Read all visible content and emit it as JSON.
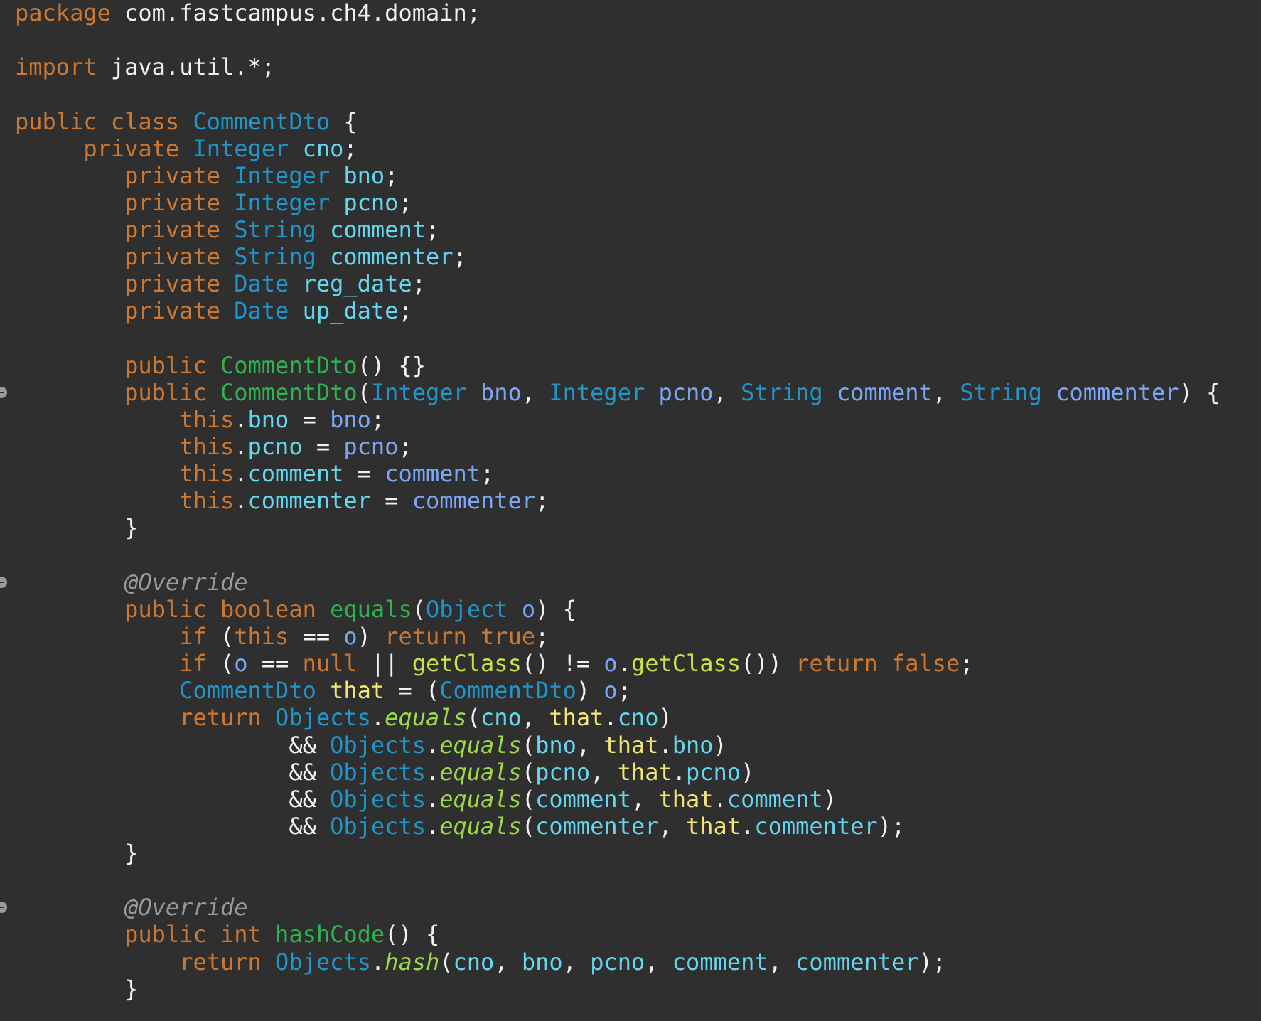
{
  "editor": {
    "language": "java",
    "theme_colors": {
      "background": "#2f2f2f",
      "plain": "#f2f2f2",
      "keyword": "#cc7832",
      "type": "#1f95c9",
      "field": "#66d6ef",
      "parameter": "#7aa6f5",
      "method_declaration": "#2fb24f",
      "method_call": "#c8e346",
      "static_method": "#9bd94a",
      "annotation": "#9a9a9a",
      "local_variable": "#f3e575"
    },
    "fold_marker_lines": [
      14,
      21,
      33
    ],
    "lines": [
      [
        [
          "kw",
          "package"
        ],
        [
          "plain",
          " com.fastcampus.ch4.domain;"
        ]
      ],
      [],
      [
        [
          "kw",
          "import"
        ],
        [
          "plain",
          " java.util.*;"
        ]
      ],
      [],
      [
        [
          "kw",
          "public class"
        ],
        [
          "plain",
          " "
        ],
        [
          "type",
          "CommentDto"
        ],
        [
          "plain",
          " {"
        ]
      ],
      [
        [
          "plain",
          "     "
        ],
        [
          "kw",
          "private"
        ],
        [
          "plain",
          " "
        ],
        [
          "type",
          "Integer"
        ],
        [
          "plain",
          " "
        ],
        [
          "field",
          "cno"
        ],
        [
          "plain",
          ";"
        ]
      ],
      [
        [
          "plain",
          "        "
        ],
        [
          "kw",
          "private"
        ],
        [
          "plain",
          " "
        ],
        [
          "type",
          "Integer"
        ],
        [
          "plain",
          " "
        ],
        [
          "field",
          "bno"
        ],
        [
          "plain",
          ";"
        ]
      ],
      [
        [
          "plain",
          "        "
        ],
        [
          "kw",
          "private"
        ],
        [
          "plain",
          " "
        ],
        [
          "type",
          "Integer"
        ],
        [
          "plain",
          " "
        ],
        [
          "field",
          "pcno"
        ],
        [
          "plain",
          ";"
        ]
      ],
      [
        [
          "plain",
          "        "
        ],
        [
          "kw",
          "private"
        ],
        [
          "plain",
          " "
        ],
        [
          "type",
          "String"
        ],
        [
          "plain",
          " "
        ],
        [
          "field",
          "comment"
        ],
        [
          "plain",
          ";"
        ]
      ],
      [
        [
          "plain",
          "        "
        ],
        [
          "kw",
          "private"
        ],
        [
          "plain",
          " "
        ],
        [
          "type",
          "String"
        ],
        [
          "plain",
          " "
        ],
        [
          "field",
          "commenter"
        ],
        [
          "plain",
          ";"
        ]
      ],
      [
        [
          "plain",
          "        "
        ],
        [
          "kw",
          "private"
        ],
        [
          "plain",
          " "
        ],
        [
          "type",
          "Date"
        ],
        [
          "plain",
          " "
        ],
        [
          "field",
          "reg_date"
        ],
        [
          "plain",
          ";"
        ]
      ],
      [
        [
          "plain",
          "        "
        ],
        [
          "kw",
          "private"
        ],
        [
          "plain",
          " "
        ],
        [
          "type",
          "Date"
        ],
        [
          "plain",
          " "
        ],
        [
          "field",
          "up_date"
        ],
        [
          "plain",
          ";"
        ]
      ],
      [],
      [
        [
          "plain",
          "        "
        ],
        [
          "kw",
          "public"
        ],
        [
          "plain",
          " "
        ],
        [
          "method",
          "CommentDto"
        ],
        [
          "plain",
          "() {}"
        ]
      ],
      [
        [
          "plain",
          "        "
        ],
        [
          "kw",
          "public"
        ],
        [
          "plain",
          " "
        ],
        [
          "method",
          "CommentDto"
        ],
        [
          "plain",
          "("
        ],
        [
          "type",
          "Integer"
        ],
        [
          "plain",
          " "
        ],
        [
          "param",
          "bno"
        ],
        [
          "plain",
          ", "
        ],
        [
          "type",
          "Integer"
        ],
        [
          "plain",
          " "
        ],
        [
          "param",
          "pcno"
        ],
        [
          "plain",
          ", "
        ],
        [
          "type",
          "String"
        ],
        [
          "plain",
          " "
        ],
        [
          "param",
          "comment"
        ],
        [
          "plain",
          ", "
        ],
        [
          "type",
          "String"
        ],
        [
          "plain",
          " "
        ],
        [
          "param",
          "commenter"
        ],
        [
          "plain",
          ") {"
        ]
      ],
      [
        [
          "plain",
          "            "
        ],
        [
          "kw",
          "this"
        ],
        [
          "plain",
          "."
        ],
        [
          "field",
          "bno"
        ],
        [
          "plain",
          " = "
        ],
        [
          "param",
          "bno"
        ],
        [
          "plain",
          ";"
        ]
      ],
      [
        [
          "plain",
          "            "
        ],
        [
          "kw",
          "this"
        ],
        [
          "plain",
          "."
        ],
        [
          "field",
          "pcno"
        ],
        [
          "plain",
          " = "
        ],
        [
          "param",
          "pcno"
        ],
        [
          "plain",
          ";"
        ]
      ],
      [
        [
          "plain",
          "            "
        ],
        [
          "kw",
          "this"
        ],
        [
          "plain",
          "."
        ],
        [
          "field",
          "comment"
        ],
        [
          "plain",
          " = "
        ],
        [
          "param",
          "comment"
        ],
        [
          "plain",
          ";"
        ]
      ],
      [
        [
          "plain",
          "            "
        ],
        [
          "kw",
          "this"
        ],
        [
          "plain",
          "."
        ],
        [
          "field",
          "commenter"
        ],
        [
          "plain",
          " = "
        ],
        [
          "param",
          "commenter"
        ],
        [
          "plain",
          ";"
        ]
      ],
      [
        [
          "plain",
          "        }"
        ]
      ],
      [],
      [
        [
          "plain",
          "        "
        ],
        [
          "annot",
          "@Override"
        ]
      ],
      [
        [
          "plain",
          "        "
        ],
        [
          "kw",
          "public boolean"
        ],
        [
          "plain",
          " "
        ],
        [
          "method",
          "equals"
        ],
        [
          "plain",
          "("
        ],
        [
          "type",
          "Object"
        ],
        [
          "plain",
          " "
        ],
        [
          "param",
          "o"
        ],
        [
          "plain",
          ") {"
        ]
      ],
      [
        [
          "plain",
          "            "
        ],
        [
          "kw",
          "if"
        ],
        [
          "plain",
          " ("
        ],
        [
          "kw",
          "this"
        ],
        [
          "plain",
          " == "
        ],
        [
          "param",
          "o"
        ],
        [
          "plain",
          ") "
        ],
        [
          "kw",
          "return true"
        ],
        [
          "plain",
          ";"
        ]
      ],
      [
        [
          "plain",
          "            "
        ],
        [
          "kw",
          "if"
        ],
        [
          "plain",
          " ("
        ],
        [
          "param",
          "o"
        ],
        [
          "plain",
          " == "
        ],
        [
          "kw",
          "null"
        ],
        [
          "plain",
          " || "
        ],
        [
          "call",
          "getClass"
        ],
        [
          "plain",
          "() != "
        ],
        [
          "param",
          "o"
        ],
        [
          "plain",
          "."
        ],
        [
          "call",
          "getClass"
        ],
        [
          "plain",
          "()) "
        ],
        [
          "kw",
          "return false"
        ],
        [
          "plain",
          ";"
        ]
      ],
      [
        [
          "plain",
          "            "
        ],
        [
          "type",
          "CommentDto"
        ],
        [
          "plain",
          " "
        ],
        [
          "local",
          "that"
        ],
        [
          "plain",
          " = ("
        ],
        [
          "type",
          "CommentDto"
        ],
        [
          "plain",
          ") "
        ],
        [
          "param",
          "o"
        ],
        [
          "plain",
          ";"
        ]
      ],
      [
        [
          "plain",
          "            "
        ],
        [
          "kw",
          "return"
        ],
        [
          "plain",
          " "
        ],
        [
          "type",
          "Objects"
        ],
        [
          "plain",
          "."
        ],
        [
          "static",
          "equals"
        ],
        [
          "plain",
          "("
        ],
        [
          "field",
          "cno"
        ],
        [
          "plain",
          ", "
        ],
        [
          "local",
          "that"
        ],
        [
          "plain",
          "."
        ],
        [
          "field",
          "cno"
        ],
        [
          "plain",
          ")"
        ]
      ],
      [
        [
          "plain",
          "                    && "
        ],
        [
          "type",
          "Objects"
        ],
        [
          "plain",
          "."
        ],
        [
          "static",
          "equals"
        ],
        [
          "plain",
          "("
        ],
        [
          "field",
          "bno"
        ],
        [
          "plain",
          ", "
        ],
        [
          "local",
          "that"
        ],
        [
          "plain",
          "."
        ],
        [
          "field",
          "bno"
        ],
        [
          "plain",
          ")"
        ]
      ],
      [
        [
          "plain",
          "                    && "
        ],
        [
          "type",
          "Objects"
        ],
        [
          "plain",
          "."
        ],
        [
          "static",
          "equals"
        ],
        [
          "plain",
          "("
        ],
        [
          "field",
          "pcno"
        ],
        [
          "plain",
          ", "
        ],
        [
          "local",
          "that"
        ],
        [
          "plain",
          "."
        ],
        [
          "field",
          "pcno"
        ],
        [
          "plain",
          ")"
        ]
      ],
      [
        [
          "plain",
          "                    && "
        ],
        [
          "type",
          "Objects"
        ],
        [
          "plain",
          "."
        ],
        [
          "static",
          "equals"
        ],
        [
          "plain",
          "("
        ],
        [
          "field",
          "comment"
        ],
        [
          "plain",
          ", "
        ],
        [
          "local",
          "that"
        ],
        [
          "plain",
          "."
        ],
        [
          "field",
          "comment"
        ],
        [
          "plain",
          ")"
        ]
      ],
      [
        [
          "plain",
          "                    && "
        ],
        [
          "type",
          "Objects"
        ],
        [
          "plain",
          "."
        ],
        [
          "static",
          "equals"
        ],
        [
          "plain",
          "("
        ],
        [
          "field",
          "commenter"
        ],
        [
          "plain",
          ", "
        ],
        [
          "local",
          "that"
        ],
        [
          "plain",
          "."
        ],
        [
          "field",
          "commenter"
        ],
        [
          "plain",
          ");"
        ]
      ],
      [
        [
          "plain",
          "        }"
        ]
      ],
      [],
      [
        [
          "plain",
          "        "
        ],
        [
          "annot",
          "@Override"
        ]
      ],
      [
        [
          "plain",
          "        "
        ],
        [
          "kw",
          "public int"
        ],
        [
          "plain",
          " "
        ],
        [
          "method",
          "hashCode"
        ],
        [
          "plain",
          "() {"
        ]
      ],
      [
        [
          "plain",
          "            "
        ],
        [
          "kw",
          "return"
        ],
        [
          "plain",
          " "
        ],
        [
          "type",
          "Objects"
        ],
        [
          "plain",
          "."
        ],
        [
          "static",
          "hash"
        ],
        [
          "plain",
          "("
        ],
        [
          "field",
          "cno"
        ],
        [
          "plain",
          ", "
        ],
        [
          "field",
          "bno"
        ],
        [
          "plain",
          ", "
        ],
        [
          "field",
          "pcno"
        ],
        [
          "plain",
          ", "
        ],
        [
          "field",
          "comment"
        ],
        [
          "plain",
          ", "
        ],
        [
          "field",
          "commenter"
        ],
        [
          "plain",
          ");"
        ]
      ],
      [
        [
          "plain",
          "        }"
        ]
      ]
    ]
  }
}
